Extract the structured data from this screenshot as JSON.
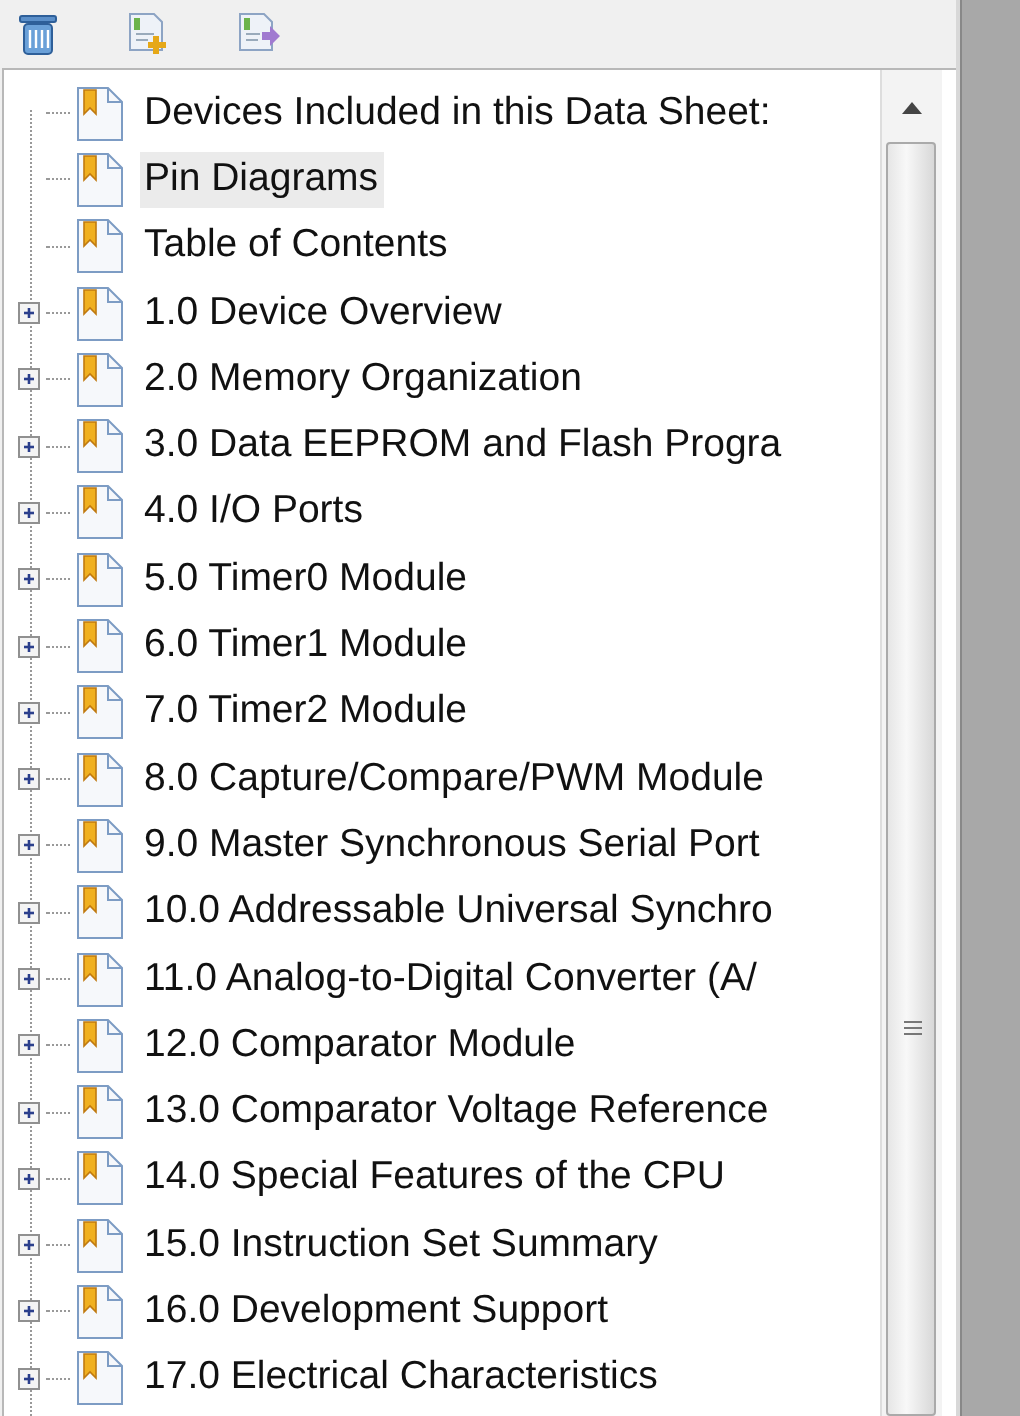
{
  "tree": {
    "items": [
      {
        "label": "Devices Included in this Data Sheet:",
        "kind": "leaf",
        "selected": false
      },
      {
        "label": "Pin Diagrams",
        "kind": "leaf",
        "selected": true
      },
      {
        "label": "Table of Contents",
        "kind": "leaf",
        "selected": false
      },
      {
        "label": "1.0 Device Overview",
        "kind": "branch",
        "expanded": false,
        "selected": false
      },
      {
        "label": "2.0 Memory Organization",
        "kind": "branch",
        "expanded": false,
        "selected": false
      },
      {
        "label": "3.0 Data EEPROM and Flash Progra",
        "kind": "branch",
        "expanded": false,
        "selected": false
      },
      {
        "label": "4.0 I/O Ports",
        "kind": "branch",
        "expanded": false,
        "selected": false
      },
      {
        "label": "5.0 Timer0 Module",
        "kind": "branch",
        "expanded": false,
        "selected": false
      },
      {
        "label": "6.0 Timer1 Module",
        "kind": "branch",
        "expanded": false,
        "selected": false
      },
      {
        "label": "7.0 Timer2 Module",
        "kind": "branch",
        "expanded": false,
        "selected": false
      },
      {
        "label": "8.0 Capture/Compare/PWM Module",
        "kind": "branch",
        "expanded": false,
        "selected": false
      },
      {
        "label": "9.0 Master Synchronous Serial Port",
        "kind": "branch",
        "expanded": false,
        "selected": false
      },
      {
        "label": "10.0 Addressable Universal Synchro",
        "kind": "branch",
        "expanded": false,
        "selected": false
      },
      {
        "label": "11.0 Analog-to-Digital Converter (A/",
        "kind": "branch",
        "expanded": false,
        "selected": false
      },
      {
        "label": "12.0 Comparator Module",
        "kind": "branch",
        "expanded": false,
        "selected": false
      },
      {
        "label": "13.0 Comparator Voltage Reference",
        "kind": "branch",
        "expanded": false,
        "selected": false
      },
      {
        "label": "14.0 Special Features of the CPU",
        "kind": "branch",
        "expanded": false,
        "selected": false
      },
      {
        "label": "15.0 Instruction Set Summary",
        "kind": "branch",
        "expanded": false,
        "selected": false
      },
      {
        "label": "16.0 Development Support",
        "kind": "branch",
        "expanded": false,
        "selected": false
      },
      {
        "label": "17.0 Electrical Characteristics",
        "kind": "branch",
        "expanded": false,
        "selected": false
      }
    ]
  }
}
